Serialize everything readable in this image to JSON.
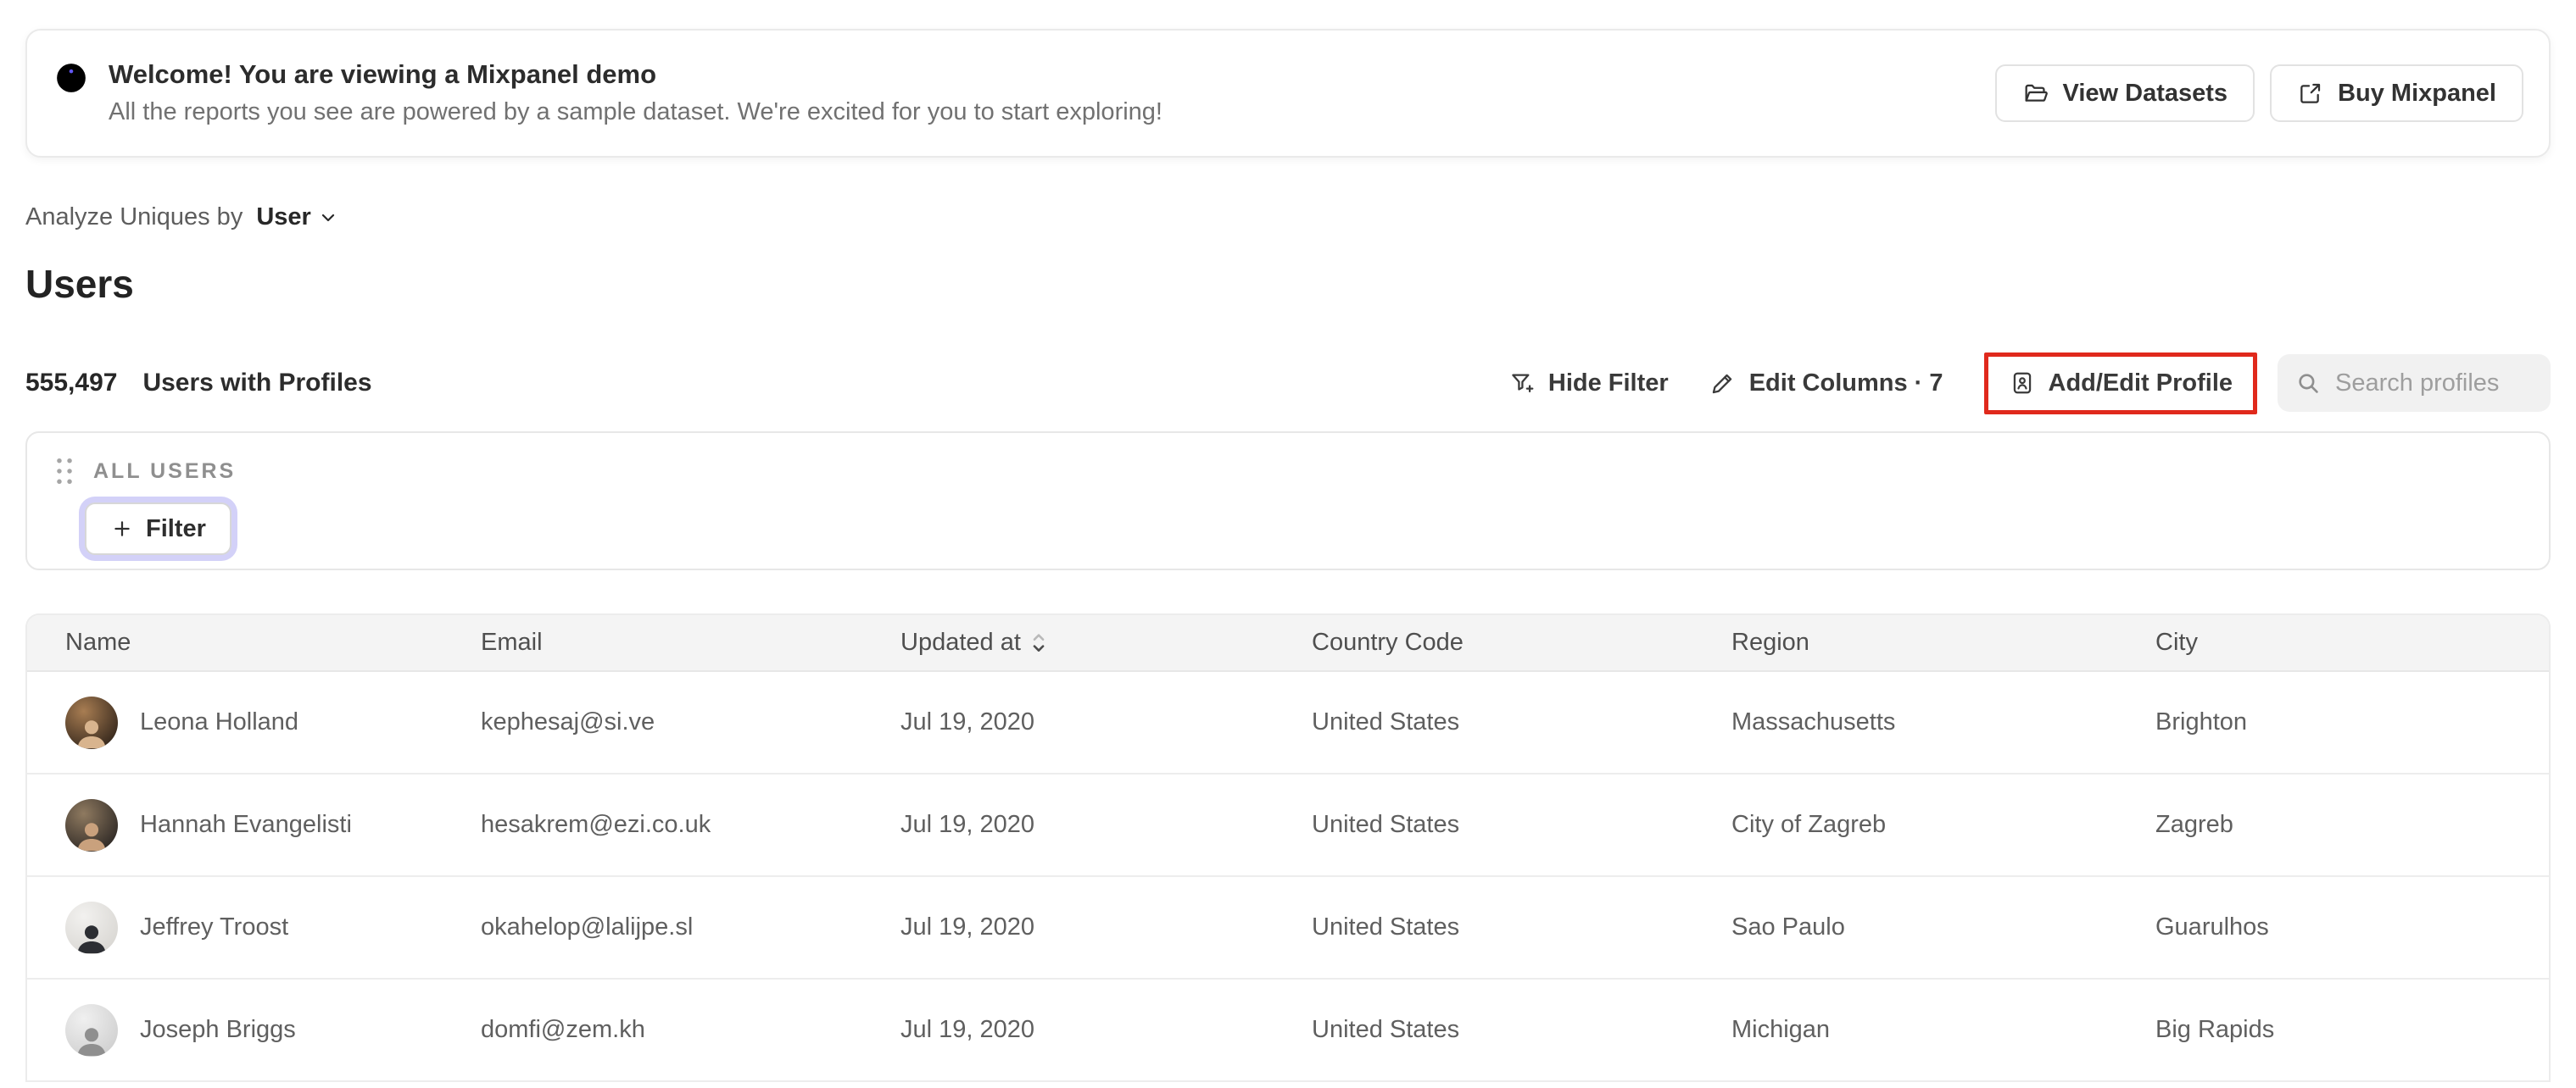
{
  "banner": {
    "title": "Welcome! You are viewing a Mixpanel demo",
    "subtitle": "All the reports you see are powered by a sample dataset. We're excited for you to start exploring!",
    "view_datasets_label": "View Datasets",
    "buy_mixpanel_label": "Buy Mixpanel"
  },
  "analyze": {
    "label": "Analyze Uniques by",
    "value": "User"
  },
  "page": {
    "title": "Users"
  },
  "summary": {
    "count": "555,497",
    "label": "Users with Profiles"
  },
  "toolbar": {
    "hide_filter_label": "Hide Filter",
    "edit_columns_label": "Edit Columns · 7",
    "add_edit_profile_label": "Add/Edit Profile",
    "search_placeholder": "Search profiles"
  },
  "filter_panel": {
    "group_label": "ALL USERS",
    "filter_button_label": "Filter"
  },
  "table": {
    "columns": [
      "Name",
      "Email",
      "Updated at",
      "Country Code",
      "Region",
      "City"
    ],
    "rows": [
      {
        "name": "Leona Holland",
        "email": "kephesaj@si.ve",
        "updated_at": "Jul 19, 2020",
        "country_code": "United States",
        "region": "Massachusetts",
        "city": "Brighton",
        "avatar": {
          "c1": "#a87d52",
          "c2": "#31241a",
          "fg": "#d8b48e"
        }
      },
      {
        "name": "Hannah Evangelisti",
        "email": "hesakrem@ezi.co.uk",
        "updated_at": "Jul 19, 2020",
        "country_code": "United States",
        "region": "City of Zagreb",
        "city": "Zagreb",
        "avatar": {
          "c1": "#8f7a60",
          "c2": "#2b2623",
          "fg": "#c9a17d"
        }
      },
      {
        "name": "Jeffrey Troost",
        "email": "okahelop@lalijpe.sl",
        "updated_at": "Jul 19, 2020",
        "country_code": "United States",
        "region": "Sao Paulo",
        "city": "Guarulhos",
        "avatar": {
          "c1": "#f2f1ef",
          "c2": "#d8d6d2",
          "fg": "#2c2e33"
        }
      },
      {
        "name": "Joseph Briggs",
        "email": "domfi@zem.kh",
        "updated_at": "Jul 19, 2020",
        "country_code": "United States",
        "region": "Michigan",
        "city": "Big Rapids",
        "avatar": {
          "c1": "#f0f0f0",
          "c2": "#cfcfcf",
          "fg": "#8f8f8f"
        }
      }
    ]
  },
  "icons": {
    "banner": "info-icon",
    "view_datasets": "open-folder-icon",
    "buy_mixpanel": "external-link-icon",
    "analyze_dropdown": "chevron-down-icon",
    "hide_filter": "funnel-plus-icon",
    "edit_columns": "pencil-icon",
    "add_edit_profile": "id-badge-user-icon",
    "search": "search-icon",
    "updated_at_sort": "sort-carets-icon",
    "filter_button": "plus-icon",
    "filter_drag": "drag-handle-icon"
  },
  "colors": {
    "accent_purple": "#6257f5",
    "highlight_red": "#e0291c",
    "filter_ring": "#d3d1f8"
  }
}
